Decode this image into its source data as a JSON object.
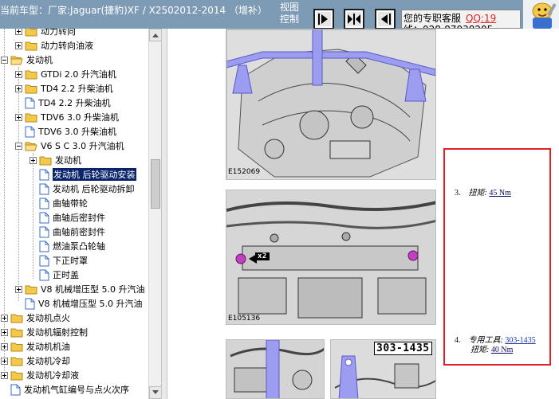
{
  "header": {
    "breadcrumb": "当前车型：厂家:Jaguar(捷豹)XF / X2502012-2014 （增补）",
    "view_control_line1": "视图",
    "view_control_line2": "控制",
    "support_line1": "您的专职客服",
    "support_qq": "QQ:19",
    "support_line2": "线：028-87038205"
  },
  "tree": {
    "items": [
      {
        "label": "动力转向",
        "depth": 1,
        "icon": "folder"
      },
      {
        "label": "动力转向油液",
        "depth": 1,
        "icon": "folder"
      },
      {
        "label": "发动机",
        "depth": 0,
        "icon": "folder-open"
      },
      {
        "label": "GTDi 2.0 升汽油机",
        "depth": 1,
        "icon": "folder"
      },
      {
        "label": "TD4 2.2 升柴油机",
        "depth": 1,
        "icon": "folder"
      },
      {
        "label": "TD4 2.2 升柴油机",
        "depth": 1,
        "icon": "doc"
      },
      {
        "label": "TDV6 3.0 升柴油机",
        "depth": 1,
        "icon": "folder"
      },
      {
        "label": "TDV6 3.0 升柴油机",
        "depth": 1,
        "icon": "doc"
      },
      {
        "label": "V6 S C 3.0 升汽油机",
        "depth": 1,
        "icon": "folder-open"
      },
      {
        "label": "发动机",
        "depth": 2,
        "icon": "folder"
      },
      {
        "label": "发动机 后轮驱动安装",
        "depth": 2,
        "icon": "doc",
        "selected": true
      },
      {
        "label": "发动机 后轮驱动拆卸",
        "depth": 2,
        "icon": "doc"
      },
      {
        "label": "曲轴带轮",
        "depth": 2,
        "icon": "doc"
      },
      {
        "label": "曲轴后密封件",
        "depth": 2,
        "icon": "doc"
      },
      {
        "label": "曲轴前密封件",
        "depth": 2,
        "icon": "doc"
      },
      {
        "label": "燃油泵凸轮轴",
        "depth": 2,
        "icon": "doc"
      },
      {
        "label": "下正时罩",
        "depth": 2,
        "icon": "doc"
      },
      {
        "label": "正时盖",
        "depth": 2,
        "icon": "doc"
      },
      {
        "label": "V8 机械增压型 5.0 升汽油",
        "depth": 1,
        "icon": "folder"
      },
      {
        "label": "V8 机械增压型 5.0 升汽油",
        "depth": 1,
        "icon": "doc"
      },
      {
        "label": "发动机点火",
        "depth": 0,
        "icon": "folder"
      },
      {
        "label": "发动机辐射控制",
        "depth": 0,
        "icon": "folder"
      },
      {
        "label": "发动机机油",
        "depth": 0,
        "icon": "folder"
      },
      {
        "label": "发动机冷却",
        "depth": 0,
        "icon": "folder"
      },
      {
        "label": "发动机冷却液",
        "depth": 0,
        "icon": "folder"
      },
      {
        "label": "发动机气缸编号与点火次序",
        "depth": 0,
        "icon": "doc"
      }
    ]
  },
  "content": {
    "figure1_caption": "E152069",
    "figure2_caption": "E105136",
    "figure2_callout": "x2",
    "figure3_tag": "303-1435",
    "steps": [
      {
        "number": "3.",
        "label": "扭矩:",
        "value": "45 Nm"
      },
      {
        "number": "4.",
        "tool_label": "专用工具:",
        "tool": "303-1435",
        "label": "扭矩:",
        "value": "40 Nm"
      }
    ]
  },
  "colors": {
    "header_bg": "#7e9bb5",
    "selection": "#0a246a",
    "highlight_box": "#e2202a",
    "tool_overlay": "#9c9cf0",
    "qq_text": "#e02020"
  }
}
